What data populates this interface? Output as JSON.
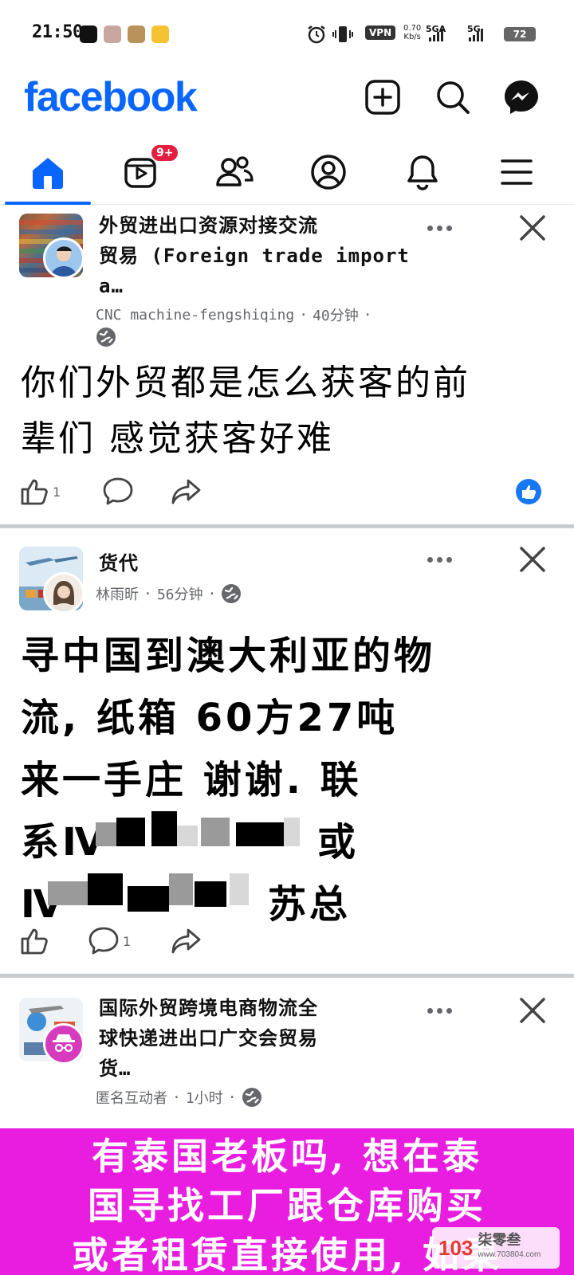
{
  "status_bar": {
    "time": "21:50",
    "vpn": "VPN",
    "speed_value": "0.70",
    "speed_unit": "Kb/s",
    "net1": "5GA",
    "net2": "5G",
    "battery": "72"
  },
  "header": {
    "logo": "facebook",
    "icons": [
      "plus-square-icon",
      "search-icon",
      "messenger-icon"
    ]
  },
  "tabs": [
    {
      "name": "home",
      "icon": "home-icon",
      "active": true
    },
    {
      "name": "video",
      "icon": "video-icon",
      "badge": "9+"
    },
    {
      "name": "friends",
      "icon": "friends-icon"
    },
    {
      "name": "profile",
      "icon": "profile-icon"
    },
    {
      "name": "notifications",
      "icon": "bell-icon"
    },
    {
      "name": "menu",
      "icon": "menu-icon"
    }
  ],
  "posts": [
    {
      "group_name_line1": "外贸进出口资源对接交流",
      "group_name_line2": "贸易 (Foreign trade import",
      "group_name_line3": "a…",
      "author": "CNC machine-fengshiqing",
      "time": "40分钟",
      "text_line1": "你们外贸都是怎么获客的前",
      "text_line2": "辈们 感觉获客好难",
      "like_count": "1",
      "reaction": "like-reaction-icon"
    },
    {
      "group_name": "货代",
      "author": "林雨昕",
      "time": "56分钟",
      "text_line1": "寻中国到澳大利亚的物",
      "text_line2": "流, 纸箱 60方27吨",
      "text_line3": "来一手庄 谢谢. 联",
      "text_line4_start": "系Ⅳ",
      "text_line4_end": "或",
      "text_line5_start": "Ⅳ",
      "text_line5_end": "苏总",
      "comment_count": "1"
    },
    {
      "group_name_line1": "国际外贸跨境电商物流全",
      "group_name_line2": "球快递进出口广交会贸易",
      "group_name_line3": "货…",
      "author": "匿名互动者",
      "time": "1小时"
    }
  ],
  "banner": {
    "line1": "有泰国老板吗, 想在泰",
    "line2": "国寻找工厂跟仓库购买",
    "line3": "或者租赁直接使用, 如果"
  },
  "watermark": {
    "logo": "103",
    "name": "柒零叁",
    "url": "www.703804.com"
  },
  "colors": {
    "brand": "#0866ff",
    "badge": "#e41e3f",
    "banner": "#e81ddf"
  }
}
